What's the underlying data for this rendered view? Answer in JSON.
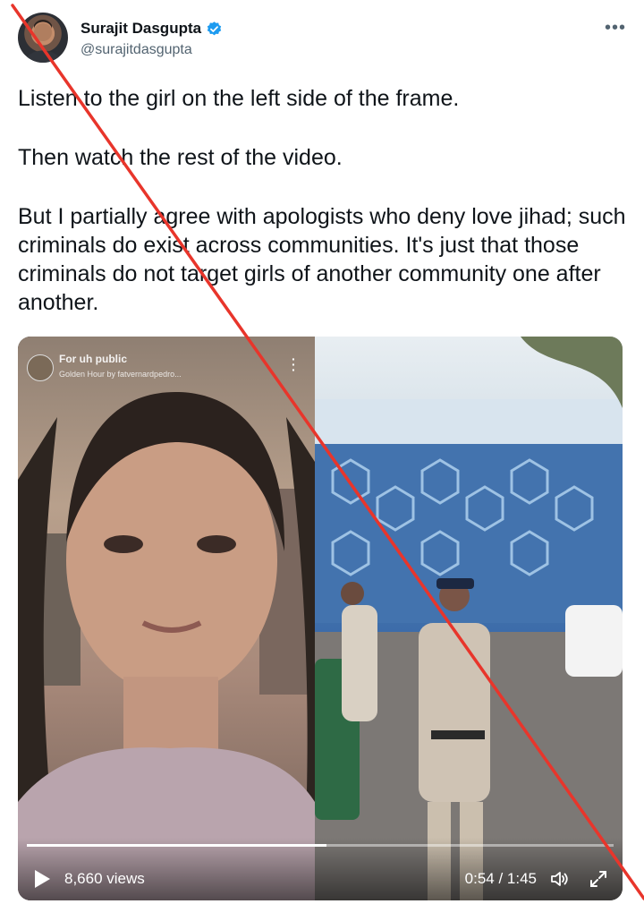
{
  "author": {
    "display_name": "Surajit Dasgupta",
    "handle": "@surajitdasgupta",
    "verified": true,
    "avatar_icon": "user-avatar"
  },
  "more_icon": "ellipsis-icon",
  "tweet": {
    "paragraphs": [
      "Listen to the girl on the left side of the frame.",
      "Then watch the rest of the video.",
      "But I partially agree with apologists who deny love jihad; such criminals do exist across communities. It's just that those criminals do not target girls of another community one after another."
    ]
  },
  "video": {
    "overlay_title": "For uh public",
    "overlay_subtitle": "Golden Hour by fatvernardpedro...",
    "views": "8,660 views",
    "time": "0:54 / 1:45",
    "progress_fraction": 0.51,
    "play_icon": "play-icon",
    "volume_icon": "volume-icon",
    "fullscreen_icon": "fullscreen-icon"
  },
  "colors": {
    "verified_blue": "#1d9bf0",
    "cross_red": "#e8352b",
    "text_primary": "#0f1419",
    "text_secondary": "#536471"
  }
}
